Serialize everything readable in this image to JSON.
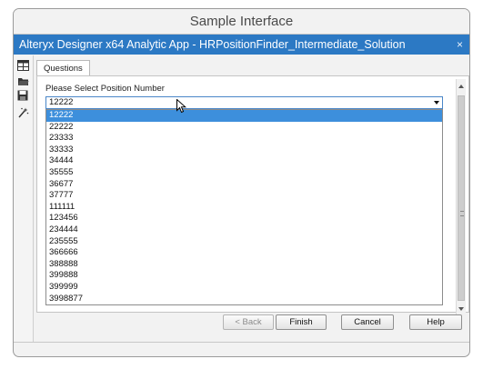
{
  "outer_window": {
    "title": "Sample Interface"
  },
  "app": {
    "title": "Alteryx Designer x64 Analytic App - HRPositionFinder_Intermediate_Solution",
    "close_glyph": "×"
  },
  "tools": [
    {
      "icon": "table-icon"
    },
    {
      "icon": "open-folder-icon"
    },
    {
      "icon": "save-icon"
    },
    {
      "icon": "magic-wand-icon"
    }
  ],
  "tabs": [
    {
      "label": "Questions"
    }
  ],
  "question": {
    "label": "Please Select Position Number",
    "selected_value": "12222",
    "options": [
      "12222",
      "22222",
      "23333",
      "33333",
      "34444",
      "35555",
      "36677",
      "37777",
      "111111",
      "123456",
      "234444",
      "235555",
      "366666",
      "388888",
      "399888",
      "399999",
      "3998877"
    ],
    "selected_index": 0
  },
  "buttons": {
    "back": "< Back",
    "finish": "Finish",
    "cancel": "Cancel",
    "help": "Help"
  },
  "colors": {
    "title_bar": "#2c79c4",
    "selection": "#3d8fdc"
  }
}
